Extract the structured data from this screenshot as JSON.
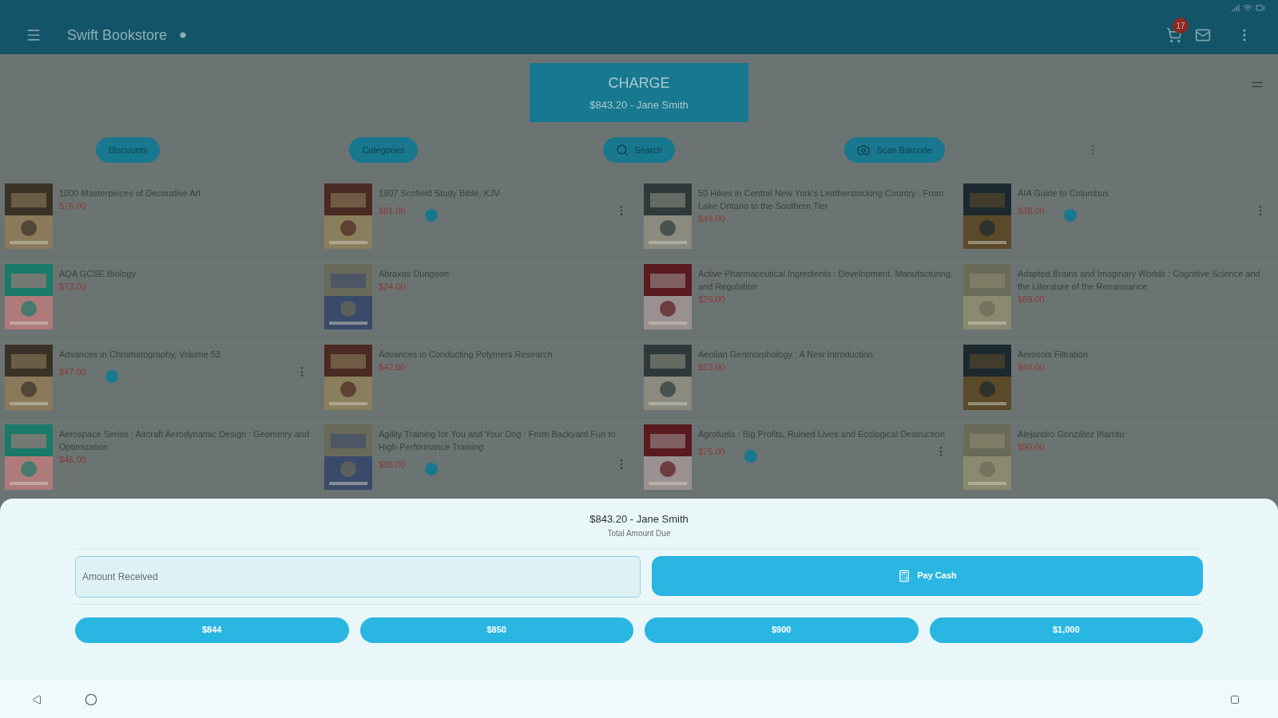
{
  "app_bar": {
    "title": "Swift Bookstore",
    "cart_count": "17"
  },
  "charge_button": {
    "label": "CHARGE",
    "amount": "$843.20 - Jane Smith"
  },
  "filter_buttons": [
    {
      "label": "Discounts",
      "kind": "plain"
    },
    {
      "label": "Categories",
      "kind": "plain"
    },
    {
      "label": "Search",
      "kind": "search"
    },
    {
      "label": "Scan Barcode",
      "kind": "camera"
    }
  ],
  "products": [
    {
      "title": "1000 Masterpieces of Decorative Art",
      "price": "$76.00",
      "badge": false,
      "menu": false
    },
    {
      "title": "1907 Scofield Study Bible, KJV",
      "price": "$81.00",
      "badge": true,
      "menu": true
    },
    {
      "title": "50 Hikes in Central New York's Leatherstocking Country : From Lake Ontario to the Southern Tier",
      "price": "$49.00",
      "badge": false,
      "menu": false
    },
    {
      "title": "AIA Guide to Columbus",
      "price": "$38.00",
      "badge": true,
      "menu": true
    },
    {
      "title": "AQA GCSE Biology",
      "price": "$73.00",
      "badge": false,
      "menu": false
    },
    {
      "title": "Abraxas Dungeon",
      "price": "$24.00",
      "badge": false,
      "menu": false
    },
    {
      "title": "Active Pharmaceutical Ingredients : Development, Manufacturing, and Regulation",
      "price": "$29.00",
      "badge": false,
      "menu": false
    },
    {
      "title": "Adapted Brains and Imaginary Worlds : Cognitive Science and the Literature of the Renaissance",
      "price": "$69.00",
      "badge": false,
      "menu": false
    },
    {
      "title": "Advances in Chromatography, Volume 53",
      "price": "$47.00",
      "badge": true,
      "menu": true
    },
    {
      "title": "Advances in Conducting Polymers Research",
      "price": "$42.00",
      "badge": false,
      "menu": false
    },
    {
      "title": "Aeolian Geomorphology : A New Introduction",
      "price": "$23.00",
      "badge": false,
      "menu": false
    },
    {
      "title": "Aerosols Filtration",
      "price": "$49.00",
      "badge": false,
      "menu": false
    },
    {
      "title": "Aerospace Series : Aircraft Aerodynamic Design : Geometry and Optimization",
      "price": "$46.00",
      "badge": false,
      "menu": false
    },
    {
      "title": "Agility Training for You and Your Dog : From Backyard Fun to High-Performance Training",
      "price": "$88.00",
      "badge": true,
      "menu": true
    },
    {
      "title": "Agrofuels : Big Profits, Ruined Lives and Ecological Destruction",
      "price": "$75.00",
      "badge": true,
      "menu": true
    },
    {
      "title": "Alejandro González Iñárritu",
      "price": "$90.00",
      "badge": false,
      "menu": false
    }
  ],
  "payment_sheet": {
    "total": "$843.20 - Jane Smith",
    "total_caption": "Total Amount Due",
    "amount_field": {
      "placeholder": "Amount Received"
    },
    "pay_button": "Pay Cash",
    "quick_amounts": [
      "$844",
      "$850",
      "$900",
      "$1,000"
    ]
  }
}
